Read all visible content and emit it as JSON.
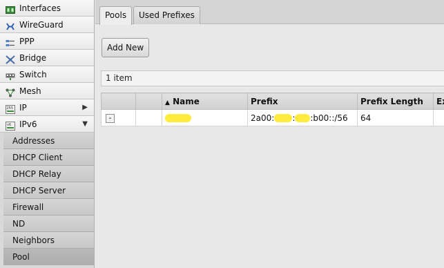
{
  "sidebar": {
    "items": [
      {
        "label": "Interfaces",
        "icon": "interfaces-icon"
      },
      {
        "label": "WireGuard",
        "icon": "wireguard-icon"
      },
      {
        "label": "PPP",
        "icon": "ppp-icon"
      },
      {
        "label": "Bridge",
        "icon": "bridge-icon"
      },
      {
        "label": "Switch",
        "icon": "switch-icon"
      },
      {
        "label": "Mesh",
        "icon": "mesh-icon"
      },
      {
        "label": "IP",
        "icon": "ip-icon",
        "arrow": "▶"
      },
      {
        "label": "IPv6",
        "icon": "ipv6-icon",
        "arrow": "▼"
      }
    ],
    "subitems": [
      "Addresses",
      "DHCP Client",
      "DHCP Relay",
      "DHCP Server",
      "Firewall",
      "ND",
      "Neighbors",
      "Pool"
    ],
    "active_subitem": "Pool"
  },
  "tabs": [
    "Pools",
    "Used Prefixes"
  ],
  "active_tab": "Pools",
  "toolbar": {
    "add_new": "Add New"
  },
  "item_count": "1 item",
  "table": {
    "sort_indicator": "▲",
    "columns": [
      "",
      "",
      "Name",
      "Prefix",
      "Prefix Length",
      "Ex"
    ],
    "rows": [
      {
        "remove": "-",
        "name": "",
        "prefix_start": "2a00:",
        "prefix_sep": ":",
        "prefix_end": ":b00::/56",
        "prefix_length": "64"
      }
    ]
  },
  "colors": {
    "redaction": "#ffec3d",
    "sidebar_bg": "#d9d9d9",
    "header_bg": "#d4d4d4"
  }
}
